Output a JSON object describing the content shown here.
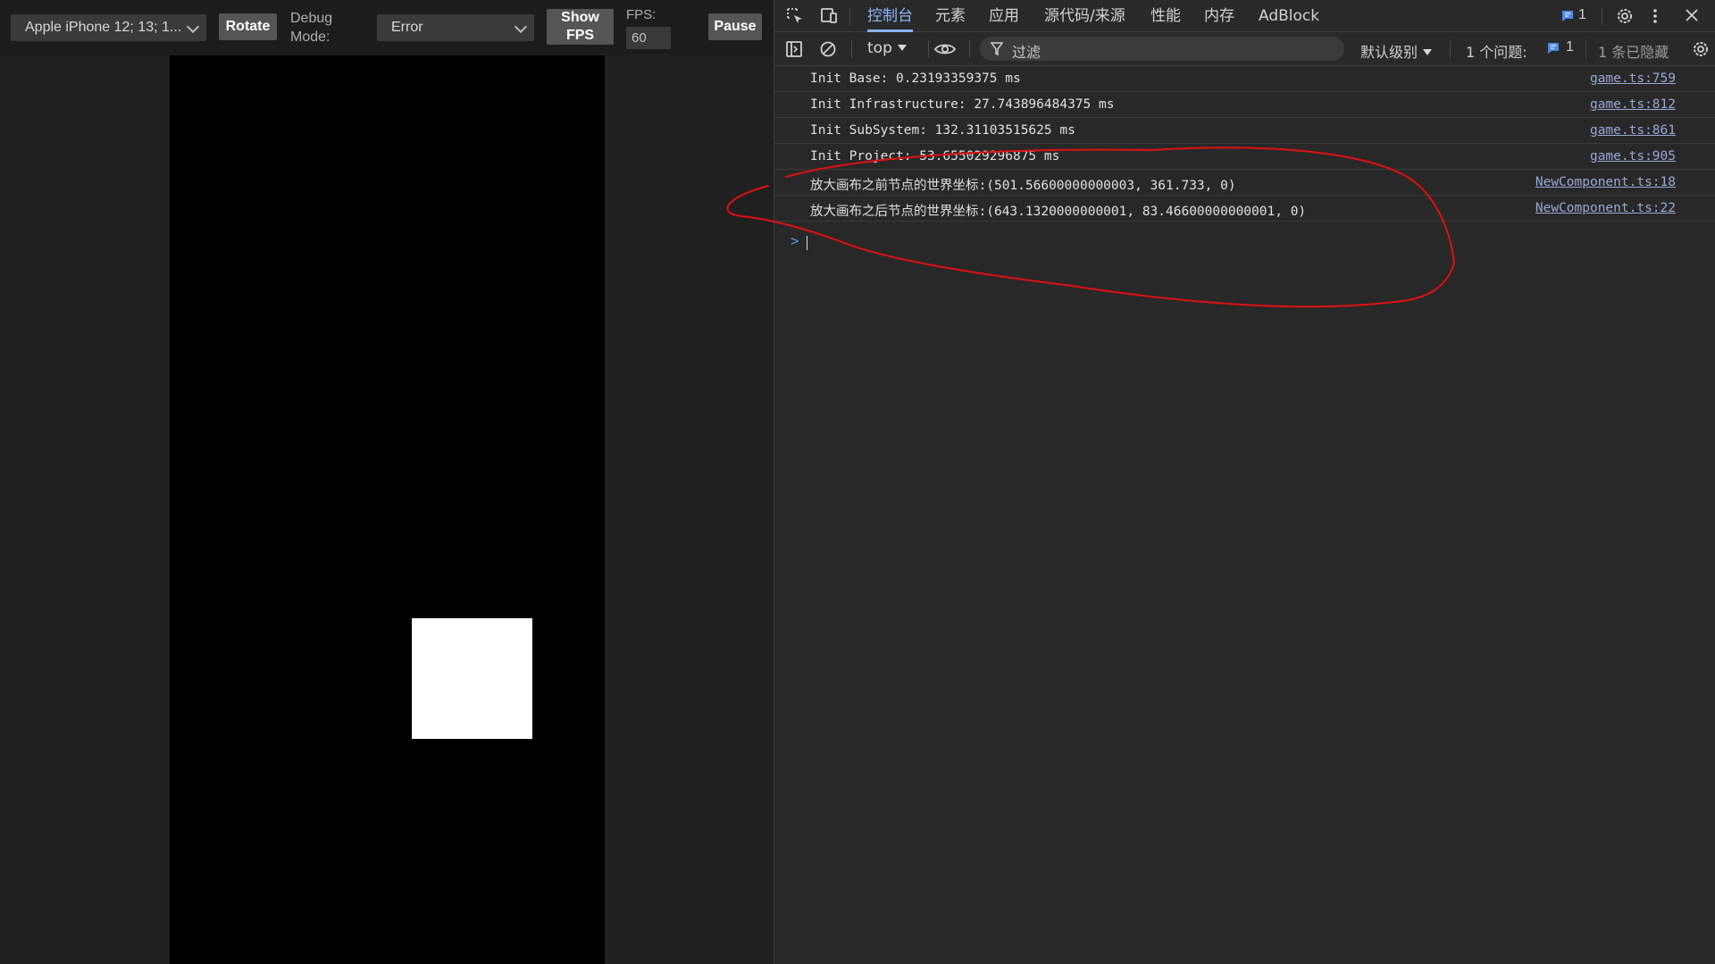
{
  "preview": {
    "device_select": "Apple iPhone 12; 13; 1...",
    "rotate_label": "Rotate",
    "debug_mode_label": "Debug\nMode:",
    "debug_mode_value": "Error",
    "show_fps_label": "Show\nFPS",
    "fps_label": "FPS:",
    "fps_value": "60",
    "pause_label": "Pause"
  },
  "devtools": {
    "tabs": [
      {
        "label": "控制台",
        "active": true
      },
      {
        "label": "元素",
        "active": false
      },
      {
        "label": "应用",
        "active": false
      },
      {
        "label": "源代码/来源",
        "active": false
      },
      {
        "label": "性能",
        "active": false
      },
      {
        "label": "内存",
        "active": false
      },
      {
        "label": "AdBlock",
        "active": false
      }
    ],
    "issues_badge": "1",
    "toolbar": {
      "context": "top",
      "filter_placeholder": "过滤",
      "level": "默认级别",
      "issues_label": "1 个问题:",
      "issues_count": "1",
      "hidden_label": "1 条已隐藏"
    },
    "console_logs": [
      {
        "message": "Init Base: 0.23193359375 ms",
        "source": "game.ts:759"
      },
      {
        "message": "Init Infrastructure: 27.743896484375 ms",
        "source": "game.ts:812"
      },
      {
        "message": "Init SubSystem: 132.31103515625 ms",
        "source": "game.ts:861"
      },
      {
        "message": "Init Project: 53.655029296875 ms",
        "source": "game.ts:905"
      },
      {
        "message": "放大画布之前节点的世界坐标:(501.56600000000003, 361.733, 0)",
        "source": "NewComponent.ts:18"
      },
      {
        "message": "放大画布之后节点的世界坐标:(643.1320000000001, 83.46600000000001, 0)",
        "source": "NewComponent.ts:22"
      }
    ],
    "prompt_symbol": ">"
  },
  "colors": {
    "accent": "#8ab4f8",
    "annotation": "#e01010"
  }
}
